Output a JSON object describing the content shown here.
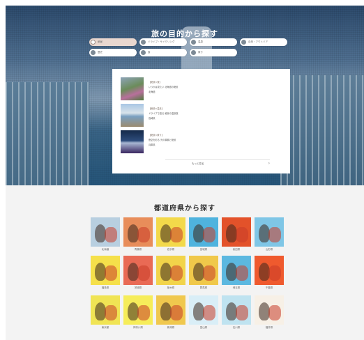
{
  "hero": {
    "title": "旅の目的から探す",
    "purposes": [
      {
        "label": "絶景",
        "active": true
      },
      {
        "label": "ドライブ・サイクリング",
        "active": false
      },
      {
        "label": "温泉",
        "active": false
      },
      {
        "label": "自然・アウトドア",
        "active": false
      },
      {
        "label": "歴史",
        "active": false
      },
      {
        "label": "食",
        "active": false
      },
      {
        "label": "祭り",
        "active": false
      }
    ],
    "results": [
      {
        "category": "【絶景×食】",
        "line1": "いつかは見たい 北海道の絶景",
        "line2": "北海道"
      },
      {
        "category": "【絶景×温泉】",
        "line1": "ドライブで巡る 絶景の温泉旅",
        "line2": "長崎県"
      },
      {
        "category": "【絶景×祭り】",
        "line1": "夜空を彩る 光の祭典と絶景",
        "line2": "兵庫県"
      }
    ],
    "more_label": "もっと見る",
    "more_chevron": "›"
  },
  "prefectures": {
    "title": "都道府県から探す",
    "rows": [
      [
        {
          "name": "北海道",
          "bg": "#b8cfe0"
        },
        {
          "name": "青森県",
          "bg": "#e88d5a"
        },
        {
          "name": "岩手県",
          "bg": "#f3d94a"
        },
        {
          "name": "宮城県",
          "bg": "#4fb3de"
        },
        {
          "name": "秋田県",
          "bg": "#e3522a"
        },
        {
          "name": "山形県",
          "bg": "#7fc6e6"
        }
      ],
      [
        {
          "name": "福島県",
          "bg": "#f5e04a"
        },
        {
          "name": "茨城県",
          "bg": "#e96a55"
        },
        {
          "name": "栃木県",
          "bg": "#f2d44a"
        },
        {
          "name": "群馬県",
          "bg": "#f0c84a"
        },
        {
          "name": "埼玉県",
          "bg": "#5cb8e0"
        },
        {
          "name": "千葉県",
          "bg": "#ef5a2e"
        }
      ],
      [
        {
          "name": "東京都",
          "bg": "#f0e454"
        },
        {
          "name": "神奈川県",
          "bg": "#f6ed5a"
        },
        {
          "name": "新潟県",
          "bg": "#f0c84e"
        },
        {
          "name": "富山県",
          "bg": "#d9eef7"
        },
        {
          "name": "石川県",
          "bg": "#bfe3f0"
        },
        {
          "name": "福井県",
          "bg": "#f7f0e6"
        }
      ]
    ]
  }
}
